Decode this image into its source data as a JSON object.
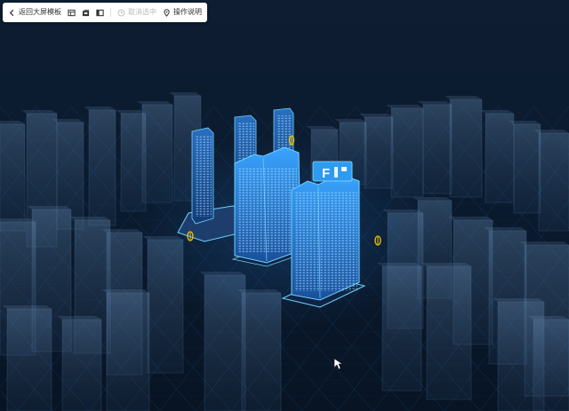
{
  "toolbar": {
    "back_label": "返回大屏模板",
    "back_icon": "chevron-left-icon",
    "view_icons": [
      "layers-icon",
      "cube-icon",
      "box-icon"
    ],
    "deselect_label": "取消选中",
    "deselect_icon": "clock-icon",
    "deselect_enabled": false,
    "help_label": "操作说明",
    "help_icon": "location-pin-icon"
  },
  "scene": {
    "highlight_sign": "F",
    "colors": {
      "background": "#0a1626",
      "grid": "#1d4f7a",
      "ghost_building": "#5a7fa6",
      "highlight_building": "#2f86e6",
      "highlight_edge": "#6fd2ff",
      "marker": "#f2c300"
    }
  }
}
